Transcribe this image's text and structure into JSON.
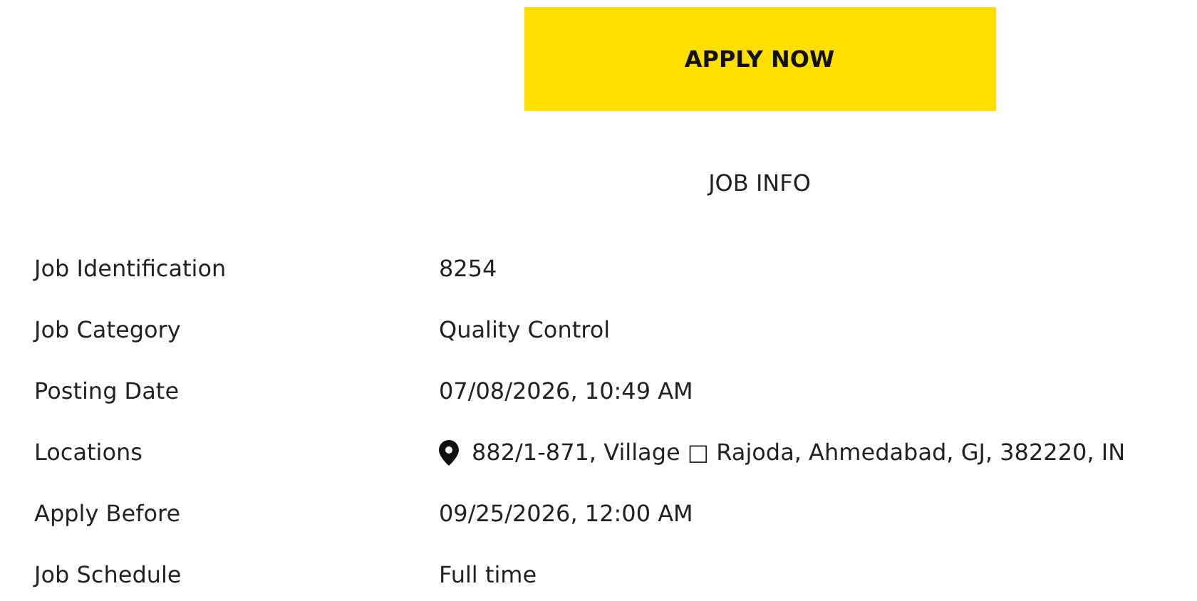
{
  "apply_button": {
    "label": "APPLY NOW"
  },
  "section_title": "JOB INFO",
  "fields": [
    {
      "label": "Job Identification",
      "value": "8254",
      "kind": "text"
    },
    {
      "label": "Job Category",
      "value": "Quality Control",
      "kind": "text"
    },
    {
      "label": "Posting Date",
      "value": "07/08/2026, 10:49 AM",
      "kind": "text"
    },
    {
      "label": "Locations",
      "value": "882/1-871, Village □ Rajoda, Ahmedabad, GJ, 382220, IN",
      "kind": "location"
    },
    {
      "label": "Apply Before",
      "value": "09/25/2026, 12:00 AM",
      "kind": "text"
    },
    {
      "label": "Job Schedule",
      "value": "Full time",
      "kind": "text"
    }
  ]
}
